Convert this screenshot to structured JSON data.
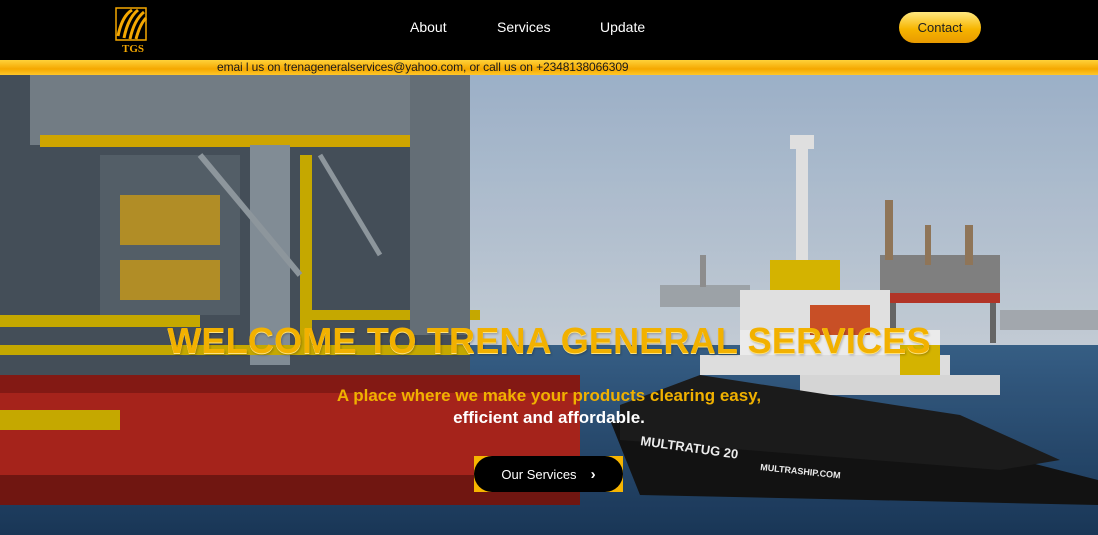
{
  "nav": {
    "logo_text": "TGS",
    "links": [
      "About",
      "Services",
      "Update"
    ],
    "contact_label": "Contact"
  },
  "info_bar": {
    "text": "emai l us on trenageneralservices@yahoo.com, or call us on +2348138066309"
  },
  "hero": {
    "title": "WELCOME TO TRENA GENERAL SERVICES",
    "subtitle_line1": "A place where we make your products clearing easy,",
    "subtitle_line2": "efficient and affordable.",
    "cta_label": "Our Services",
    "tug_name": "MULTRATUG 20",
    "tug_site": "MULTRASHIP.COM"
  },
  "colors": {
    "accent": "#f7b500",
    "navbar": "#000000",
    "sea": "#2a4f7a",
    "sky": "#b8c9dd"
  },
  "icons": {
    "cta": "chevron-right-icon",
    "logo": "tgs-logo-icon"
  }
}
